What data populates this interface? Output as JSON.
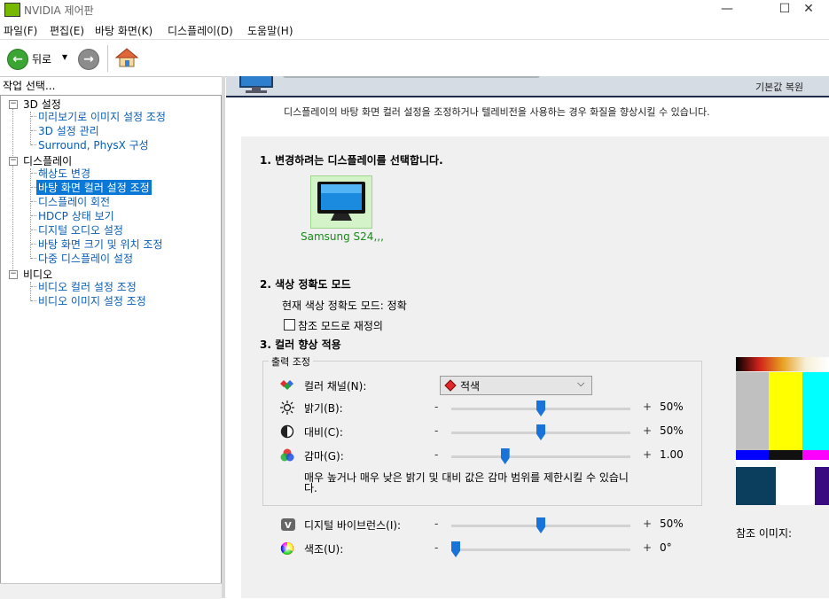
{
  "window": {
    "title": "NVIDIA 제어판",
    "min": "—",
    "max": "☐",
    "close": "✕"
  },
  "menu": [
    "파일(F)",
    "편집(E)",
    "바탕 화면(K)",
    "디스플레이(D)",
    "도움말(H)"
  ],
  "toolbar": {
    "back_label": "뒤로",
    "back_dropdown": "▾"
  },
  "sidebar": {
    "title": "작업 선택...",
    "categories": [
      {
        "label": "3D 설정",
        "items": [
          "미리보기로 이미지 설정 조정",
          "3D 설정 관리",
          "Surround, PhysX 구성"
        ]
      },
      {
        "label": "디스플레이",
        "items": [
          "해상도 변경",
          "바탕 화면 컬러 설정 조정",
          "디스플레이 회전",
          "HDCP 상태 보기",
          "디지털 오디오 설정",
          "바탕 화면 크기 및 위치 조정",
          "다중 디스플레이 설정"
        ]
      },
      {
        "label": "비디오",
        "items": [
          "비디오 컬러 설정 조정",
          "비디오 이미지 설정 조정"
        ]
      }
    ],
    "selected": "바탕 화면 컬러 설정 조정"
  },
  "header": {
    "restore_defaults": "기본값 복원",
    "description": "디스플레이의 바탕 화면 컬러 설정을 조정하거나 텔레비전을 사용하는 경우 화질을 향상시킬 수 있습니다."
  },
  "section1": {
    "title": "1. 변경하려는 디스플레이를 선택합니다.",
    "display_name": "Samsung S24,,,"
  },
  "section2": {
    "title": "2. 색상 정확도 모드",
    "current_mode": "현재 색상 정확도 모드: 정확",
    "override_label": "참조 모드로 재정의",
    "override_checked": false
  },
  "section3": {
    "title": "3. 컬러 향상 적용",
    "group_label": "출력 조정",
    "channel_label": "컬러 채널(N):",
    "channel_value": "적색",
    "sliders": [
      {
        "label": "밝기(B):",
        "value_text": "50%",
        "fraction": 0.5,
        "icon": "sun-icon"
      },
      {
        "label": "대비(C):",
        "value_text": "50%",
        "fraction": 0.5,
        "icon": "contrast-icon"
      },
      {
        "label": "감마(G):",
        "value_text": "1.00",
        "fraction": 0.29,
        "icon": "rgb-circles-icon"
      }
    ],
    "note": "매우 높거나 매우 낮은 밝기 및 대비 값은 감마 범위를 제한시킬 수 있습니다.",
    "vibrance": {
      "label": "디지털 바이브런스(I):",
      "value_text": "50%",
      "fraction": 0.5
    },
    "hue": {
      "label": "색조(U):",
      "value_text": "0°",
      "fraction": 0.0
    },
    "minus": "-",
    "plus": "+"
  },
  "reference_image_label": "참조 이미지:",
  "colors": {
    "accent": "#0a78d7",
    "link": "#0a5db5",
    "nvidia_green": "#76b900"
  }
}
